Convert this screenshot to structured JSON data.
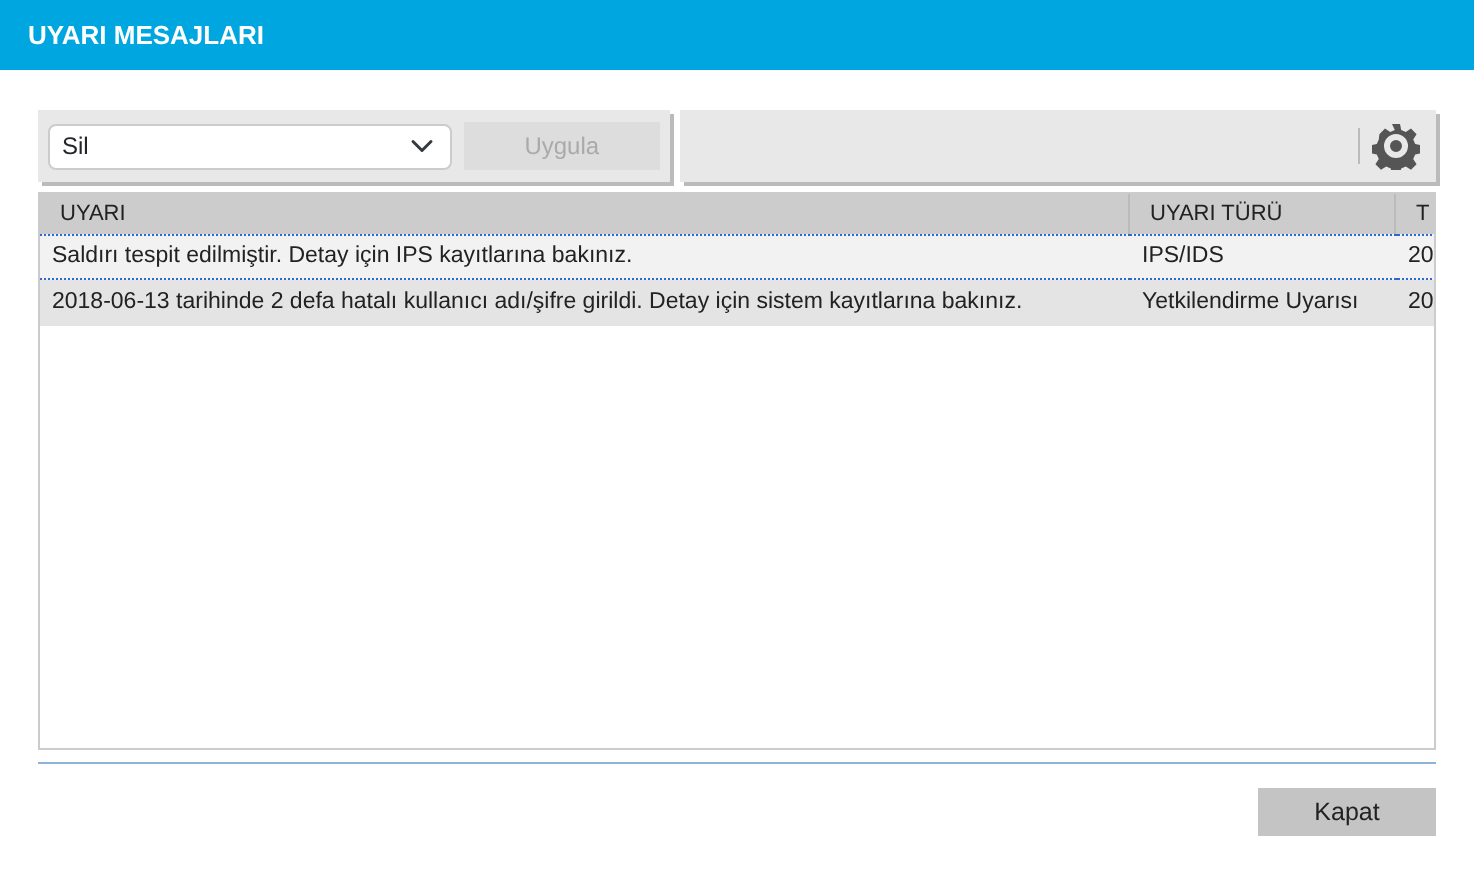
{
  "window": {
    "title": "UYARI MESAJLARI"
  },
  "toolbar": {
    "action_select": {
      "value": "Sil"
    },
    "apply_button": {
      "label": "Uygula",
      "disabled": true
    }
  },
  "table": {
    "columns": [
      "UYARI",
      "UYARI TÜRÜ",
      "T"
    ],
    "rows": [
      {
        "cells": [
          "Saldırı tespit edilmiştir. Detay için IPS kayıtlarına bakınız.",
          "IPS/IDS",
          "20"
        ],
        "selected": true
      },
      {
        "cells": [
          "2018-06-13 tarihinde 2 defa hatalı kullanıcı adı/şifre girildi. Detay için sistem kayıtlarına bakınız.",
          "Yetkilendirme Uyarısı",
          "20"
        ],
        "selected": false
      }
    ]
  },
  "buttons": [
    "Kapat"
  ]
}
